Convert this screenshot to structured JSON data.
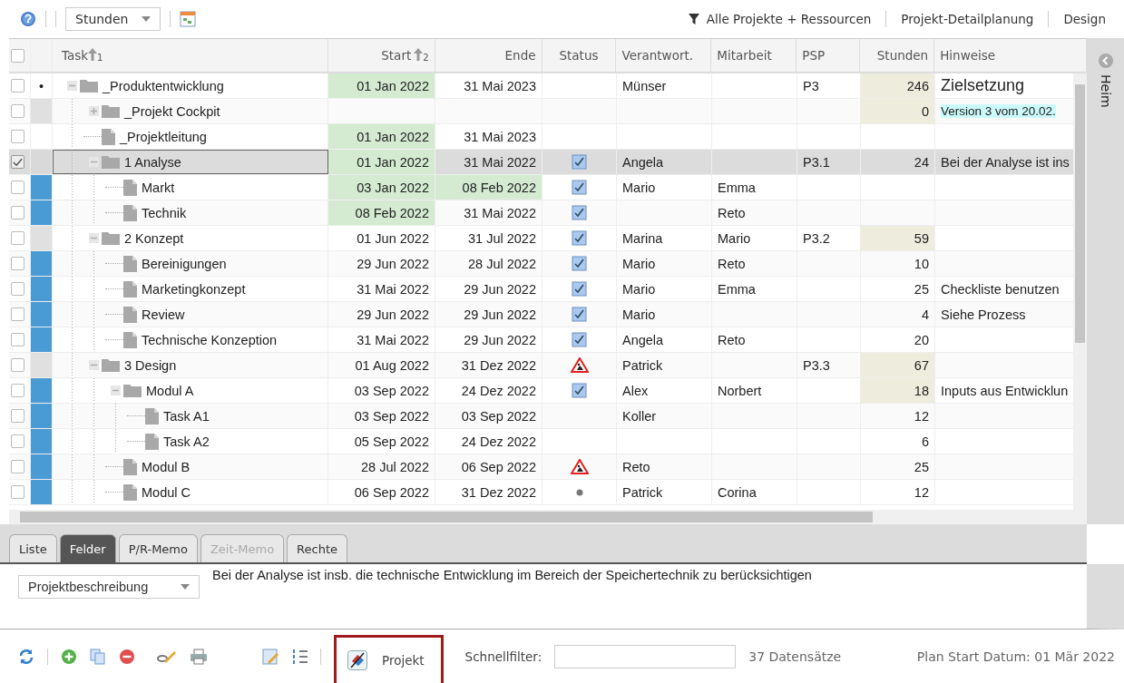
{
  "toolbar": {
    "unit_dropdown": "Stunden",
    "filter_label": "Alle Projekte + Ressourcen",
    "links": [
      "Projekt-Detailplanung",
      "Design"
    ]
  },
  "select_all_checked": false,
  "columns": [
    {
      "label": "Task",
      "sort": "1"
    },
    {
      "label": "Start",
      "sort": "2"
    },
    {
      "label": "Ende"
    },
    {
      "label": "Status"
    },
    {
      "label": "Verantwort."
    },
    {
      "label": "Mitarbeit"
    },
    {
      "label": "PSP"
    },
    {
      "label": "Stunden"
    },
    {
      "label": "Hinweise"
    }
  ],
  "rows": [
    {
      "task": "_Produktentwicklung",
      "kind": "folder",
      "expanded": true,
      "checked": false,
      "selected": false,
      "bullet": "•",
      "start": "01 Jan 2022",
      "start_hl": true,
      "end": "31 Mai 2023",
      "end_hl": false,
      "owner": "Münser",
      "psp": "P3",
      "hours": "246",
      "hours_hl": true,
      "note": {
        "text": "Zielsetzung",
        "kind": "heading"
      },
      "children": [
        {
          "task": "_Projekt Cockpit",
          "kind": "folder",
          "expanded": false,
          "checked": false,
          "selected": false,
          "color": "#e0e0e0",
          "start_hl": false,
          "end_hl": false,
          "hours": "0",
          "hours_hl": true,
          "note": {
            "text": "Version 3 vom 20.02.",
            "kind": "highlight"
          }
        },
        {
          "task": "_Projektleitung",
          "kind": "file",
          "checked": false,
          "selected": false,
          "start": "01 Jan 2022",
          "start_hl": true,
          "end": "31 Mai 2023",
          "end_hl": false,
          "hours_hl": false
        },
        {
          "task": "1 Analyse",
          "kind": "folder",
          "expanded": true,
          "checked": true,
          "selected": true,
          "color": "#d9d9d9",
          "start": "01 Jan 2022",
          "start_hl": true,
          "end": "31 Mai 2022",
          "end_hl": false,
          "status": {
            "kind": "check"
          },
          "owner": "Angela",
          "psp": "P3.1",
          "hours": "24",
          "hours_hl": false,
          "note": {
            "text": "Bei der Analyse ist ins",
            "kind": "plain"
          },
          "children": [
            {
              "task": "Markt",
              "kind": "file",
              "checked": false,
              "selected": false,
              "color": "#4a9ad4",
              "start": "03 Jan 2022",
              "start_hl": true,
              "end": "08 Feb 2022",
              "end_hl": true,
              "status": {
                "kind": "check"
              },
              "owner": "Mario",
              "staff": "Emma",
              "hours_hl": false
            },
            {
              "task": "Technik",
              "kind": "file",
              "checked": false,
              "selected": false,
              "color": "#4a9ad4",
              "start": "08 Feb 2022",
              "start_hl": true,
              "end": "31 Mai 2022",
              "end_hl": false,
              "status": {
                "kind": "check"
              },
              "staff": "Reto",
              "hours_hl": false
            }
          ]
        },
        {
          "task": "2 Konzept",
          "kind": "folder",
          "expanded": true,
          "checked": false,
          "selected": false,
          "color": "#e0e0e0",
          "start": "01 Jun 2022",
          "start_hl": false,
          "end": "31 Jul 2022",
          "end_hl": false,
          "status": {
            "kind": "check"
          },
          "owner": "Marina",
          "staff": "Mario",
          "psp": "P3.2",
          "hours": "59",
          "hours_hl": true,
          "children": [
            {
              "task": "Bereinigungen",
              "kind": "file",
              "checked": false,
              "selected": false,
              "color": "#4a9ad4",
              "start": "29 Jun 2022",
              "start_hl": false,
              "end": "28 Jul 2022",
              "end_hl": false,
              "status": {
                "kind": "check"
              },
              "owner": "Mario",
              "staff": "Reto",
              "hours": "10",
              "hours_hl": false
            },
            {
              "task": "Marketingkonzept",
              "kind": "file",
              "checked": false,
              "selected": false,
              "color": "#4a9ad4",
              "start": "31 Mai 2022",
              "start_hl": false,
              "end": "29 Jun 2022",
              "end_hl": false,
              "status": {
                "kind": "check"
              },
              "owner": "Mario",
              "staff": "Emma",
              "hours": "25",
              "hours_hl": false,
              "note": {
                "text": "Checkliste benutzen",
                "kind": "plain"
              }
            },
            {
              "task": "Review",
              "kind": "file",
              "checked": false,
              "selected": false,
              "color": "#4a9ad4",
              "start": "29 Jun 2022",
              "start_hl": false,
              "end": "29 Jun 2022",
              "end_hl": false,
              "status": {
                "kind": "check"
              },
              "owner": "Mario",
              "hours": "4",
              "hours_hl": false,
              "note": {
                "text": "Siehe Prozess",
                "kind": "plain"
              }
            },
            {
              "task": "Technische Konzeption",
              "kind": "file",
              "checked": false,
              "selected": false,
              "color": "#4a9ad4",
              "start": "31 Mai 2022",
              "start_hl": false,
              "end": "29 Jun 2022",
              "end_hl": false,
              "status": {
                "kind": "check"
              },
              "owner": "Angela",
              "staff": "Reto",
              "hours": "20",
              "hours_hl": false
            }
          ]
        },
        {
          "task": "3 Design",
          "kind": "folder",
          "expanded": true,
          "checked": false,
          "selected": false,
          "color": "#e0e0e0",
          "start": "01 Aug 2022",
          "start_hl": false,
          "end": "31 Dez 2022",
          "end_hl": false,
          "status": {
            "kind": "warning"
          },
          "owner": "Patrick",
          "psp": "P3.3",
          "hours": "67",
          "hours_hl": true,
          "children": [
            {
              "task": "Modul A",
              "kind": "folder",
              "expanded": true,
              "checked": false,
              "selected": false,
              "color": "#4a9ad4",
              "start": "03 Sep 2022",
              "start_hl": false,
              "end": "24 Dez 2022",
              "end_hl": false,
              "status": {
                "kind": "check"
              },
              "owner": "Alex",
              "staff": "Norbert",
              "hours": "18",
              "hours_hl": true,
              "note": {
                "text": "Inputs aus Entwicklun",
                "kind": "plain"
              },
              "children": [
                {
                  "task": "Task A1",
                  "kind": "file",
                  "checked": false,
                  "selected": false,
                  "color": "#4a9ad4",
                  "start": "03 Sep 2022",
                  "start_hl": false,
                  "end": "03 Sep 2022",
                  "end_hl": false,
                  "owner": "Koller",
                  "hours": "12",
                  "hours_hl": false
                },
                {
                  "task": "Task A2",
                  "kind": "file",
                  "checked": false,
                  "selected": false,
                  "color": "#4a9ad4",
                  "start": "05 Sep 2022",
                  "start_hl": false,
                  "end": "24 Dez 2022",
                  "end_hl": false,
                  "hours": "6",
                  "hours_hl": false
                }
              ]
            },
            {
              "task": "Modul B",
              "kind": "file",
              "checked": false,
              "selected": false,
              "color": "#4a9ad4",
              "start": "28 Jul 2022",
              "start_hl": false,
              "end": "06 Sep 2022",
              "end_hl": false,
              "status": {
                "kind": "warning"
              },
              "owner": "Reto",
              "hours": "25",
              "hours_hl": false
            },
            {
              "task": "Modul C",
              "kind": "file",
              "checked": false,
              "selected": false,
              "color": "#4a9ad4",
              "start": "06 Sep 2022",
              "start_hl": false,
              "end": "31 Dez 2022",
              "end_hl": false,
              "status": {
                "kind": "dot"
              },
              "owner": "Patrick",
              "staff": "Corina",
              "hours": "12",
              "hours_hl": false
            }
          ]
        }
      ]
    }
  ],
  "side_panel": {
    "label": "Heim"
  },
  "tabs": [
    {
      "label": "Liste",
      "selected": false,
      "disabled": false
    },
    {
      "label": "Felder",
      "selected": true,
      "disabled": false
    },
    {
      "label": "P/R-Memo",
      "selected": false,
      "disabled": false
    },
    {
      "label": "Zeit-Memo",
      "selected": false,
      "disabled": true
    },
    {
      "label": "Rechte",
      "selected": false,
      "disabled": false
    }
  ],
  "memo": {
    "field_dropdown": "Projektbeschreibung",
    "text": "Bei der Analyse ist insb. die technische Entwicklung im Bereich der Speichertechnik zu berücksichtigen"
  },
  "bottom_bar": {
    "project_button": "Projekt",
    "quick_filter_label": "Schnellfilter:",
    "record_count": "37 Datensätze",
    "plan_start": "Plan Start Datum: 01 Mär 2022"
  }
}
